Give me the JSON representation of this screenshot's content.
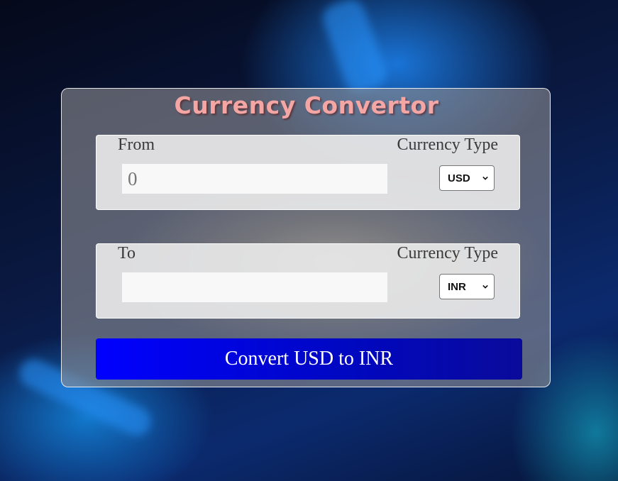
{
  "app": {
    "title": "Currency Convertor"
  },
  "from": {
    "label": "From",
    "type_label": "Currency Type",
    "amount_placeholder": "0",
    "amount_value": "",
    "currency": "USD"
  },
  "to": {
    "label": "To",
    "type_label": "Currency Type",
    "amount_value": "",
    "currency": "INR"
  },
  "action": {
    "convert_label": "Convert USD to INR"
  },
  "colors": {
    "title": "#f3a6a3",
    "button": "#0000ff"
  },
  "icons": {
    "dropdown": "chevron-down-icon"
  }
}
